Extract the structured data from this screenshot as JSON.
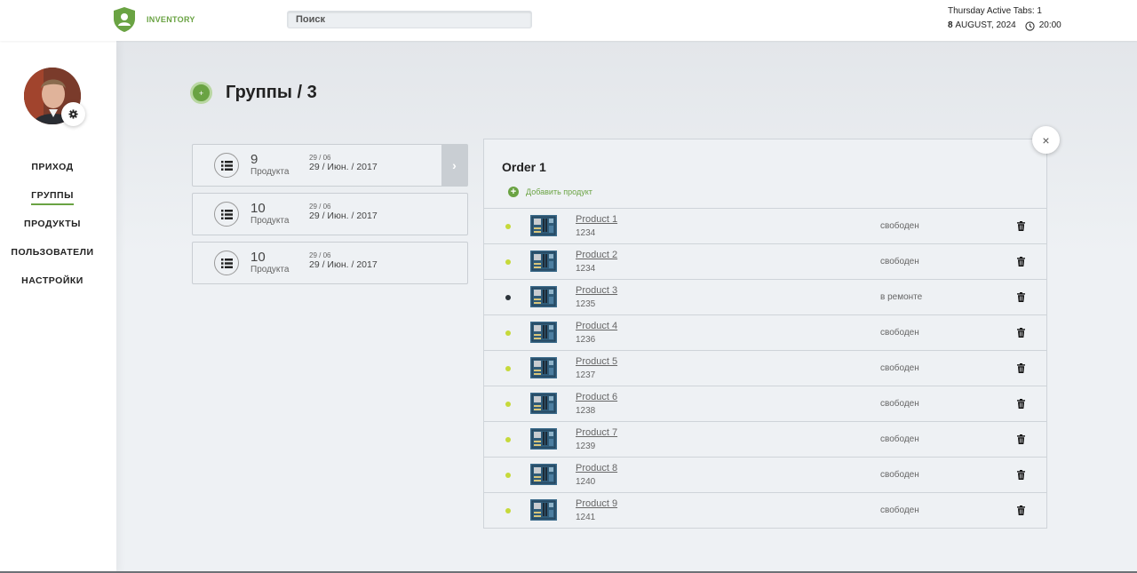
{
  "header": {
    "brand": "INVENTORY",
    "search_placeholder": "Поиск",
    "day_line": "Thursday Active Tabs: 1",
    "date_day": "8",
    "date_rest": "AUGUST, 2024",
    "time": "20:00"
  },
  "sidebar": {
    "avatar_icon": "user-avatar",
    "settings_icon": "gear-icon",
    "items": [
      {
        "label": "ПРИХОД",
        "active": false
      },
      {
        "label": "ГРУППЫ",
        "active": true
      },
      {
        "label": "ПРОДУКТЫ",
        "active": false
      },
      {
        "label": "ПОЛЬЗОВАТЕЛИ",
        "active": false
      },
      {
        "label": "НАСТРОЙКИ",
        "active": false
      }
    ]
  },
  "main": {
    "add_symbol": "+",
    "title": "Группы / 3",
    "groups": [
      {
        "count": "9",
        "count_label": "Продукта",
        "date_small": "29 / 06",
        "date_big": "29 / Июн. / 2017",
        "selected": true
      },
      {
        "count": "10",
        "count_label": "Продукта",
        "date_small": "29 / 06",
        "date_big": "29 / Июн. / 2017",
        "selected": false
      },
      {
        "count": "10",
        "count_label": "Продукта",
        "date_small": "29 / 06",
        "date_big": "29 / Июн. / 2017",
        "selected": false
      }
    ],
    "arrow_symbol": "›"
  },
  "order": {
    "title": "Order 1",
    "add_label": "Добавить продукт",
    "add_symbol": "+",
    "close_symbol": "×",
    "products": [
      {
        "name": "Product 1",
        "number": "1234",
        "status": "свободен",
        "dot_color": "#c6d93a"
      },
      {
        "name": "Product 2",
        "number": "1234",
        "status": "свободен",
        "dot_color": "#c6d93a"
      },
      {
        "name": "Product 3",
        "number": "1235",
        "status": "в ремонте",
        "dot_color": "#2c333a"
      },
      {
        "name": "Product 4",
        "number": "1236",
        "status": "свободен",
        "dot_color": "#c6d93a"
      },
      {
        "name": "Product 5",
        "number": "1237",
        "status": "свободен",
        "dot_color": "#c6d93a"
      },
      {
        "name": "Product 6",
        "number": "1238",
        "status": "свободен",
        "dot_color": "#c6d93a"
      },
      {
        "name": "Product 7",
        "number": "1239",
        "status": "свободен",
        "dot_color": "#c6d93a"
      },
      {
        "name": "Product 8",
        "number": "1240",
        "status": "свободен",
        "dot_color": "#c6d93a"
      },
      {
        "name": "Product 9",
        "number": "1241",
        "status": "свободен",
        "dot_color": "#c6d93a"
      }
    ]
  },
  "colors": {
    "accent": "#6aa343",
    "status_free": "#c6d93a",
    "status_repair": "#2c333a"
  }
}
